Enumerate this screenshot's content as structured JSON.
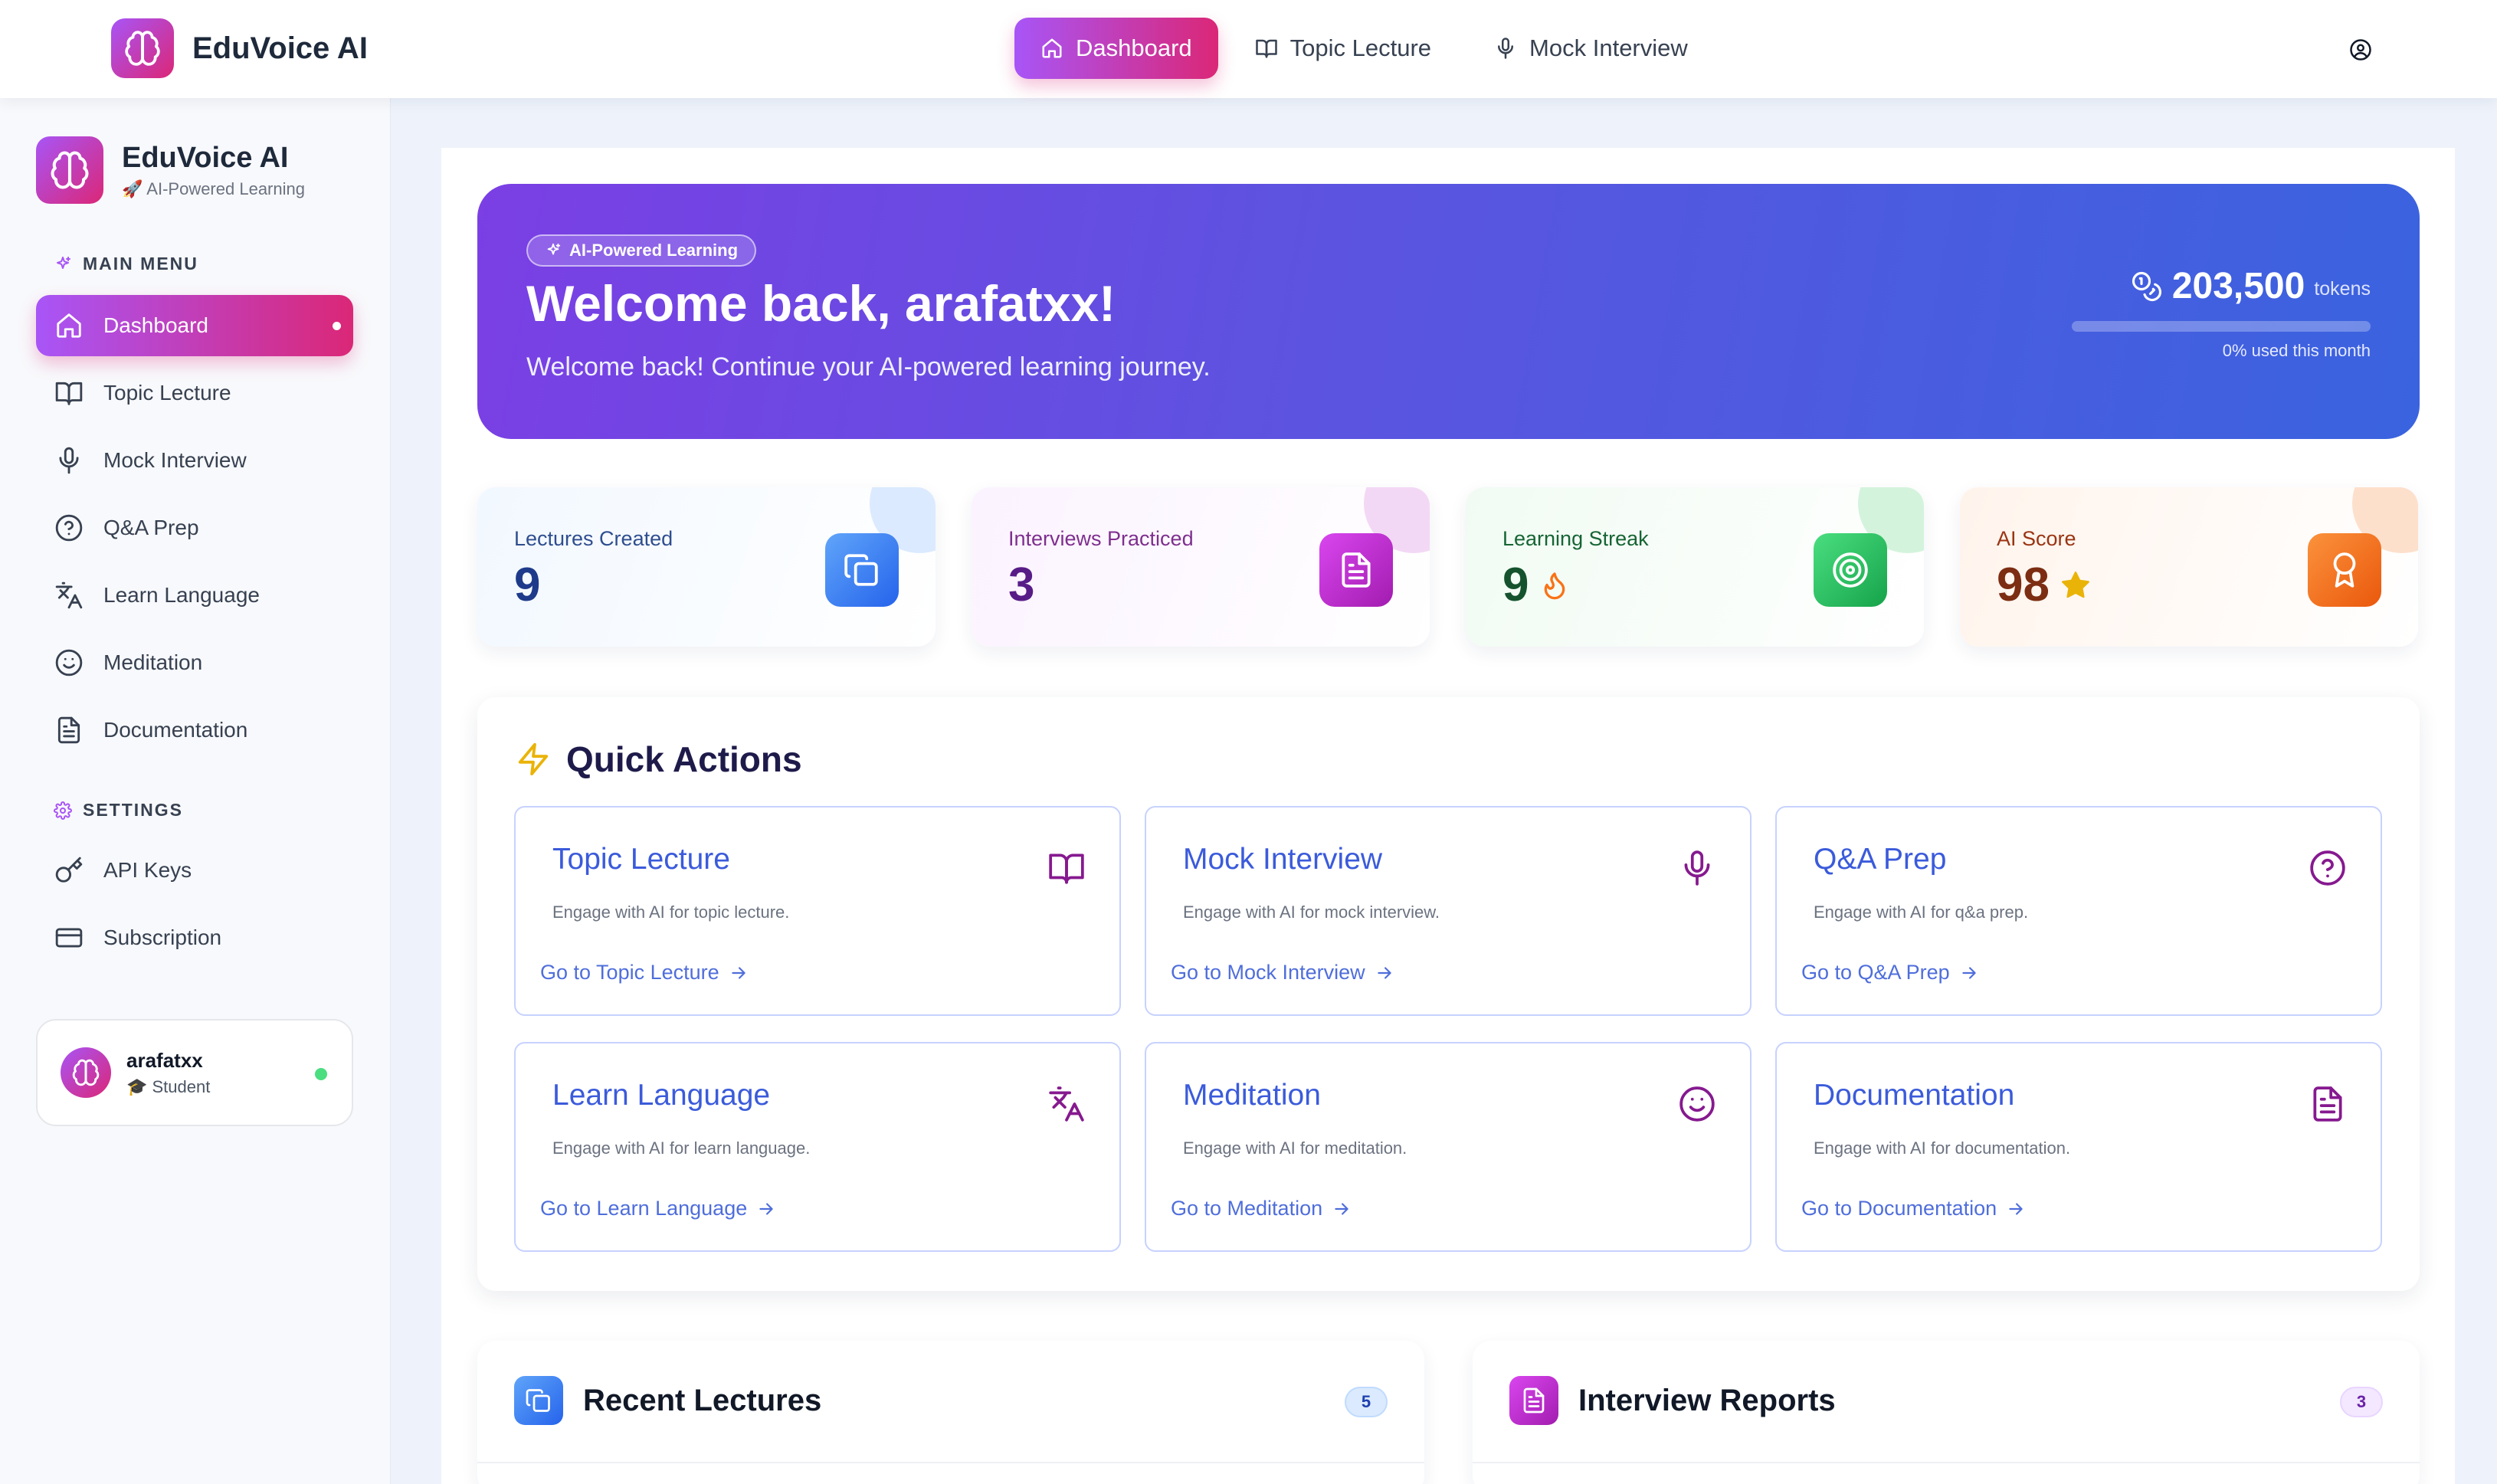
{
  "app": {
    "name": "EduVoice AI",
    "tagline": "🚀 AI-Powered Learning"
  },
  "topnav": {
    "links": [
      {
        "label": "Dashboard",
        "icon": "home-icon",
        "active": true
      },
      {
        "label": "Topic Lecture",
        "icon": "book-icon",
        "active": false
      },
      {
        "label": "Mock Interview",
        "icon": "microphone-icon",
        "active": false
      }
    ],
    "profile_icon": "user-circle-icon"
  },
  "sidebar": {
    "main_menu_label": "MAIN MENU",
    "items": [
      {
        "label": "Dashboard",
        "icon": "home-icon",
        "active": true
      },
      {
        "label": "Topic Lecture",
        "icon": "book-icon"
      },
      {
        "label": "Mock Interview",
        "icon": "microphone-icon"
      },
      {
        "label": "Q&A Prep",
        "icon": "question-circle-icon"
      },
      {
        "label": "Learn Language",
        "icon": "translate-icon"
      },
      {
        "label": "Meditation",
        "icon": "smile-icon"
      },
      {
        "label": "Documentation",
        "icon": "document-icon"
      }
    ],
    "settings_label": "SETTINGS",
    "settings_items": [
      {
        "label": "API Keys",
        "icon": "key-icon"
      },
      {
        "label": "Subscription",
        "icon": "credit-card-icon"
      }
    ],
    "user": {
      "name": "arafatxx",
      "role": "🎓 Student",
      "status": "online"
    }
  },
  "hero": {
    "badge": "AI-Powered Learning",
    "title": "Welcome back, arafatxx!",
    "subtitle": "Welcome back! Continue your AI-powered learning journey.",
    "tokens_value": "203,500",
    "tokens_unit": "tokens",
    "tokens_used_fraction": 0,
    "tokens_note": "0% used this month"
  },
  "stats": [
    {
      "label": "Lectures Created",
      "value": "9",
      "icon": "copy-icon",
      "label_color": "#2f4e8f",
      "value_color": "#1e3a8a",
      "icon_bg": "#3b82f6"
    },
    {
      "label": "Interviews Practiced",
      "value": "3",
      "icon": "document-icon",
      "label_color": "#7e2f8e",
      "value_color": "#581c87",
      "icon_bg": "#c026d3"
    },
    {
      "label": "Learning Streak",
      "value": "9",
      "icon": "target-icon",
      "extra_icon": "flame-icon",
      "label_color": "#166534",
      "value_color": "#14532d",
      "icon_bg": "#22c55e"
    },
    {
      "label": "AI Score",
      "value": "98",
      "icon": "award-icon",
      "extra_icon": "star-icon",
      "label_color": "#9a3412",
      "value_color": "#7c2d12",
      "icon_bg": "#f97316"
    }
  ],
  "quick_actions": {
    "title": "Quick Actions",
    "items": [
      {
        "title": "Topic Lecture",
        "desc": "Engage with AI for topic lecture.",
        "link": "Go to Topic Lecture",
        "icon": "book-icon"
      },
      {
        "title": "Mock Interview",
        "desc": "Engage with AI for mock interview.",
        "link": "Go to Mock Interview",
        "icon": "microphone-icon"
      },
      {
        "title": "Q&A Prep",
        "desc": "Engage with AI for q&a prep.",
        "link": "Go to Q&A Prep",
        "icon": "question-circle-icon"
      },
      {
        "title": "Learn Language",
        "desc": "Engage with AI for learn language.",
        "link": "Go to Learn Language",
        "icon": "translate-icon"
      },
      {
        "title": "Meditation",
        "desc": "Engage with AI for meditation.",
        "link": "Go to Meditation",
        "icon": "smile-icon"
      },
      {
        "title": "Documentation",
        "desc": "Engage with AI for documentation.",
        "link": "Go to Documentation",
        "icon": "document-icon"
      }
    ]
  },
  "recent_lectures": {
    "title": "Recent Lectures",
    "count": "5"
  },
  "interview_reports": {
    "title": "Interview Reports",
    "count": "3"
  }
}
